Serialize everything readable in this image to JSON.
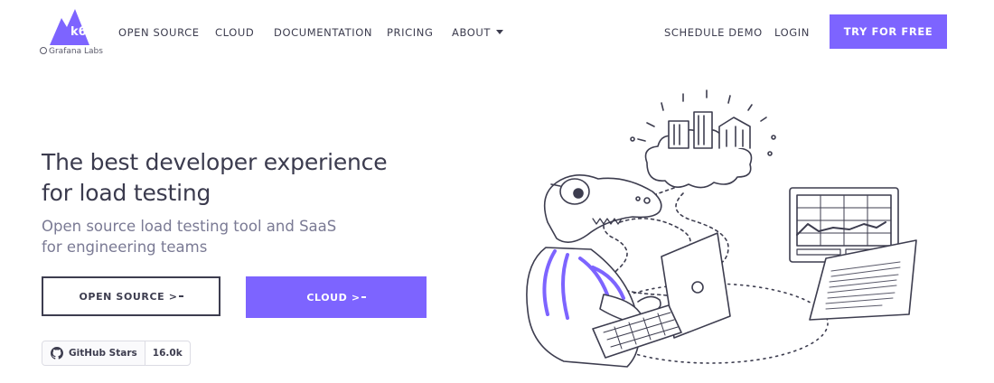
{
  "brand": {
    "logo_text": "k6",
    "sublabel": "Grafana Labs",
    "color": "#7d64ff"
  },
  "nav": {
    "open_source": "OPEN SOURCE",
    "cloud": "CLOUD",
    "documentation": "DOCUMENTATION",
    "pricing": "PRICING",
    "about": "ABOUT",
    "schedule_demo": "SCHEDULE DEMO",
    "login": "LOGIN",
    "try_free": "TRY FOR FREE"
  },
  "hero": {
    "title_line1": "The best developer experience",
    "title_line2": "for load testing",
    "subtitle_line1": "Open source load testing tool and SaaS",
    "subtitle_line2": "for engineering teams",
    "btn_open_source": "OPEN SOURCE >",
    "btn_cloud": "CLOUD >"
  },
  "github": {
    "label": "GitHub Stars",
    "count": "16.0k"
  },
  "icons": [
    "k6-logo-icon",
    "grafana-icon",
    "caret-down-icon",
    "github-icon",
    "mascot-illustration"
  ]
}
